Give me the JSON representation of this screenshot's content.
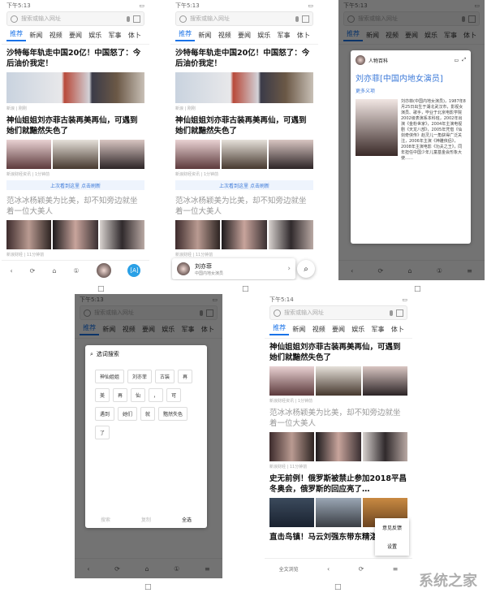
{
  "status": {
    "time": "下午5:13",
    "time2": "下午5:14"
  },
  "search": {
    "placeholder": "搜索或输入网址"
  },
  "tabs": [
    "推荐",
    "新闻",
    "视频",
    "要闻",
    "娱乐",
    "军事",
    "体卜"
  ],
  "articles": {
    "a1": {
      "title": "沙特每年轨走中国20亿！中国怒了：今后油价我定！",
      "meta": "新浪 | 刚刚"
    },
    "a2": {
      "title": "神仙姐姐刘亦菲古装再美再仙，可遇到她们就黯然失色了",
      "meta": "新浪财经资讯 | 1分钟前"
    },
    "a3": {
      "title": "范冰冰杨颖美为比美，却不知旁边就坐着一位大美人",
      "meta": "新浪财经 | 11分钟前"
    },
    "a4": {
      "title": "史无前例！俄罗斯被禁止参加2018平昌冬奥会，俄罗斯的回应亮了…"
    },
    "a5": {
      "title": "直击鸟镇！马云刘强东带东精湛挂 "
    }
  },
  "refresh": "上次看到这里 点击刷新",
  "baike": {
    "source": "人物百科",
    "title": "刘亦菲[中国内地女演员]",
    "more": "更多义项",
    "body": "刘亦菲(中国内地女演员)，1987年8月25日出生于湖北武汉市，影视女演员、歌手，毕业于北京电影学院2002级表演系本科班，2002年出演《金粉世家》，2004年主演电视剧《天龙八部》，2005年凭借《仙剑奇侠传》赵灵儿一角获得广泛关注，2006年主演《神雕侠侣》，2008年主演电影《功夫之王》，同年担任中国少年儿童基金会形象大使……"
  },
  "person_card": {
    "name": "刘亦菲",
    "desc": "中国内地女演员"
  },
  "word_select": {
    "title": "选词搜索",
    "words": [
      "神仙姐姐",
      "刘亦菲",
      "古装",
      "再",
      "美",
      "再",
      "仙",
      "，",
      "可",
      "遇到",
      "她们",
      "就",
      "黯然失色",
      "了"
    ],
    "search": "搜索",
    "copy": "复制",
    "select_all": "全选"
  },
  "menu": {
    "feedback": "意见反馈",
    "settings": "设置"
  },
  "bottom_label": "全文浏览",
  "watermark": "系统之家",
  "colors": {
    "accent": "#1a73e8",
    "refresh_bg": "#eef4fd"
  }
}
